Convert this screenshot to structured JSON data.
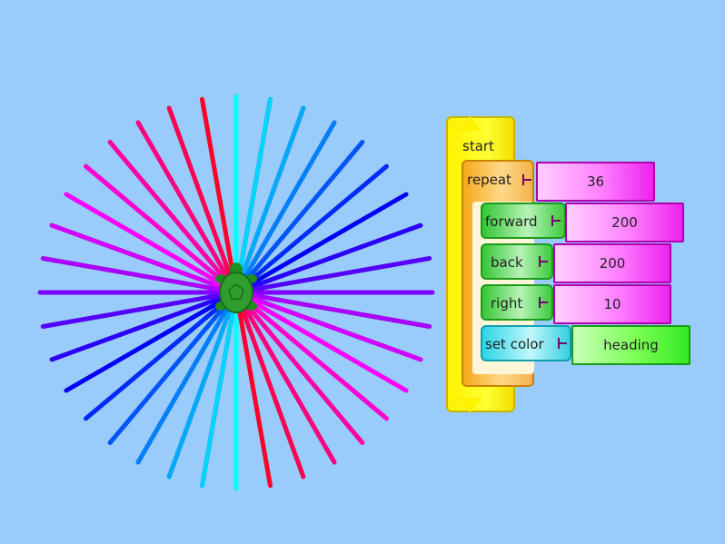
{
  "program": {
    "start_label": "start",
    "repeat": {
      "label": "repeat",
      "count": "36"
    },
    "forward": {
      "label": "forward",
      "value": "200"
    },
    "back": {
      "label": "back",
      "value": "200"
    },
    "right": {
      "label": "right",
      "value": "10"
    },
    "set_color": {
      "label": "set color",
      "value": "heading"
    }
  },
  "drawing": {
    "line_count": 36,
    "radius": 216,
    "turn_deg": 10,
    "turtle_color": "#1f8f1f"
  },
  "colors": {
    "background": "#99ccfa"
  }
}
